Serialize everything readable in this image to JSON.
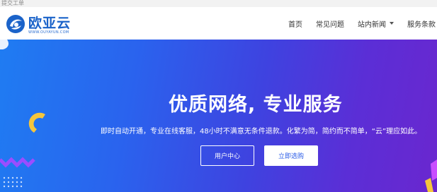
{
  "utility_bar": {
    "text": "提交工单"
  },
  "logo": {
    "name": "欧亚云",
    "domain": "WWW.OUYAYUN.COM",
    "brand_color": "#1b63c9"
  },
  "nav": {
    "items": [
      {
        "label": "首页"
      },
      {
        "label": "常见问题"
      },
      {
        "label": "站内新闻",
        "has_dropdown": true
      },
      {
        "label": "服务条款"
      }
    ]
  },
  "hero": {
    "title": "优质网络, 专业服务",
    "subtitle": "即时自动开通，专业在线客服，48小时不满意无条件退款。化繁为简，简约而不简单，“云”理应如此。",
    "buttons": {
      "user_center": "用户中心",
      "buy_now": "立即选购"
    },
    "gradient_colors": [
      "#1f7cf2",
      "#6a27cf"
    ],
    "accent_yellow": "#f5c63c",
    "accent_purple": "#9b4dff"
  }
}
